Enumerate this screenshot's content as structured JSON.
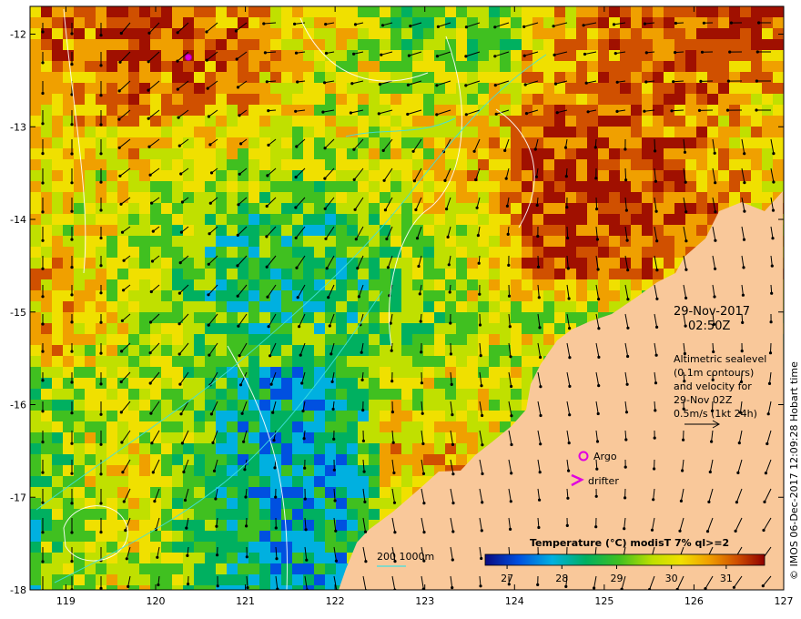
{
  "map": {
    "lon_ticks": [
      "119",
      "120",
      "121",
      "122",
      "123",
      "124",
      "125",
      "126",
      "127"
    ],
    "lat_ticks": [
      "-12",
      "-13",
      "-14",
      "-15",
      "-16",
      "-17",
      "-18"
    ],
    "lon_range": [
      118.6,
      127.0
    ],
    "lat_range": [
      -18.0,
      -11.7
    ]
  },
  "annotations": {
    "date": "29-Nov-2017",
    "time": "02:50Z",
    "altimetry_lines": [
      "Altimetric sealevel",
      "(0.1m contours)",
      "and velocity for",
      "29-Nov 02Z",
      "0.5m/s (1kt 24h)"
    ],
    "argo_label": "Argo",
    "drifter_label": "drifter",
    "bathy_label": "200  1000m",
    "credit": "© IMOS 06-Dec-2017 12:09:28 Hobart time"
  },
  "colorbar": {
    "title": "Temperature (°C) modisT 7% ql>=2",
    "ticks": [
      "27",
      "28",
      "29",
      "30",
      "31"
    ],
    "range": [
      26.6,
      31.7
    ]
  },
  "colors": {
    "land": "#f9c89a",
    "argo": "#e000e0",
    "drifter": "#e000e0",
    "bathy": "#40e0e0"
  },
  "icons": {
    "argo": "circle-marker-icon",
    "drifter": "chevron-marker-icon",
    "velocity_scale": "arrow-icon"
  }
}
